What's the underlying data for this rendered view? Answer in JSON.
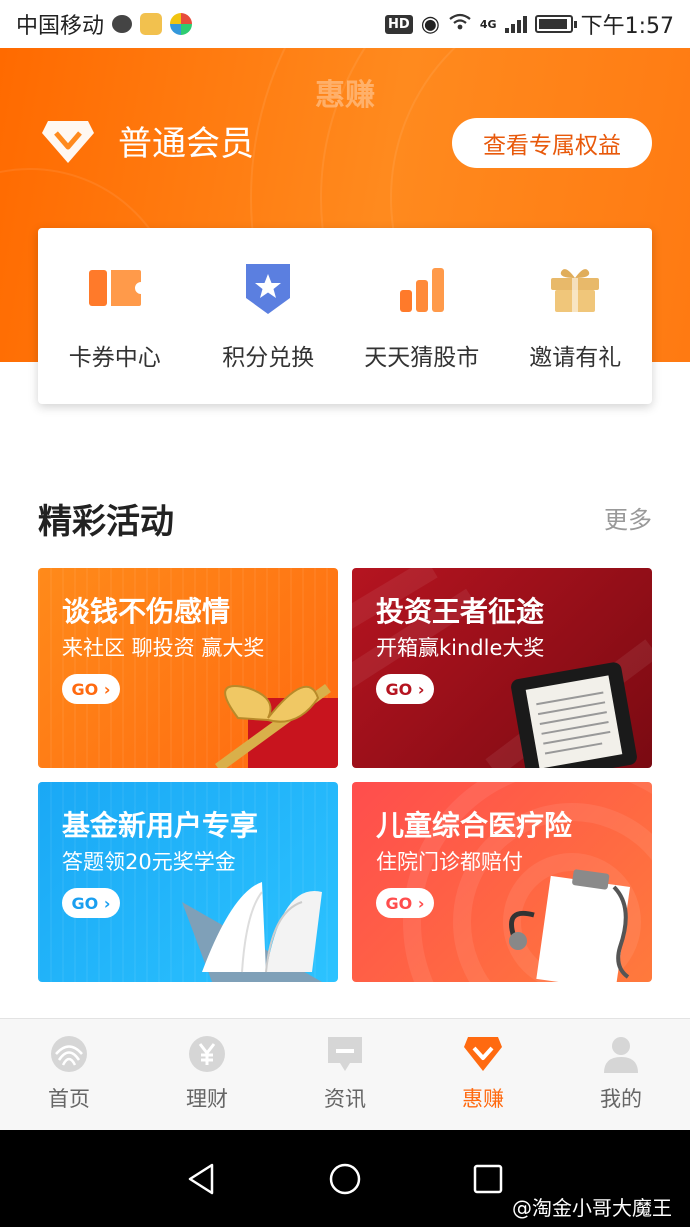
{
  "status_bar": {
    "carrier": "中国移动",
    "time": "下午1:57",
    "hd": "HD",
    "network": "4G"
  },
  "header": {
    "title": "惠赚",
    "member_level": "普通会员",
    "benefit_button": "查看专属权益"
  },
  "quick_links": [
    {
      "label": "卡券中心",
      "icon": "coupon-icon"
    },
    {
      "label": "积分兑换",
      "icon": "points-badge-icon"
    },
    {
      "label": "天天猜股市",
      "icon": "bar-chart-icon"
    },
    {
      "label": "邀请有礼",
      "icon": "gift-icon"
    }
  ],
  "activities": {
    "title": "精彩活动",
    "more": "更多",
    "cards": [
      {
        "title": "谈钱不伤感情",
        "subtitle": "来社区 聊投资 赢大奖",
        "go": "GO",
        "color": "#ff7a14"
      },
      {
        "title": "投资王者征途",
        "subtitle": "开箱赢kindle大奖",
        "go": "GO",
        "color": "#a3101c"
      },
      {
        "title": "基金新用户专享",
        "subtitle": "答题领20元奖学金",
        "go": "GO",
        "color": "#1fb0f8"
      },
      {
        "title": "儿童综合医疗险",
        "subtitle": "住院门诊都赔付",
        "go": "GO",
        "color": "#ff5a44"
      }
    ]
  },
  "bottom_nav": [
    {
      "label": "首页",
      "icon": "home-icon",
      "active": false
    },
    {
      "label": "理财",
      "icon": "yuan-icon",
      "active": false
    },
    {
      "label": "资讯",
      "icon": "news-icon",
      "active": false
    },
    {
      "label": "惠赚",
      "icon": "diamond-icon",
      "active": true
    },
    {
      "label": "我的",
      "icon": "user-icon",
      "active": false
    }
  ],
  "watermark": "@淘金小哥大魔王",
  "colors": {
    "accent": "#ff6a10",
    "header_bg": "#ff7a14"
  }
}
